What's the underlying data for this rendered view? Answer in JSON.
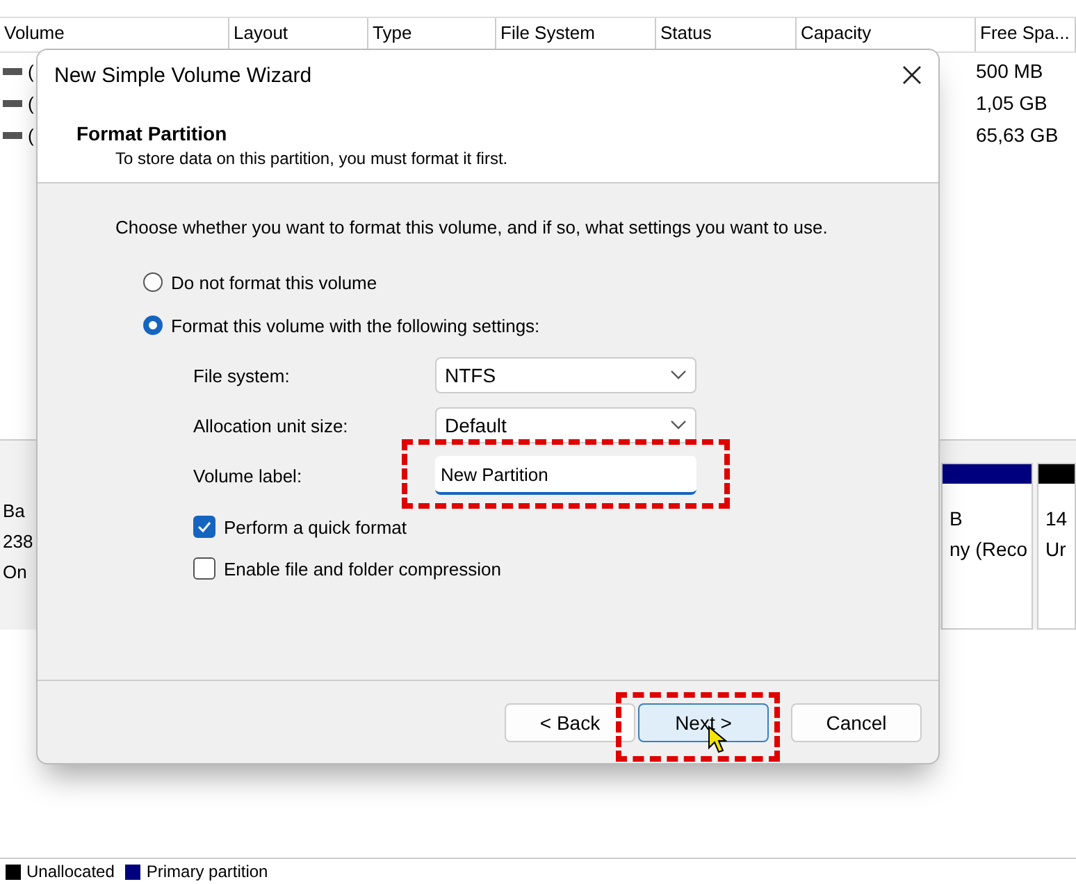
{
  "background": {
    "columns": [
      "Volume",
      "Layout",
      "Type",
      "File System",
      "Status",
      "Capacity",
      "Free Spa..."
    ],
    "rows": [
      {
        "volume": "(",
        "free_space": "500 MB"
      },
      {
        "volume": "(",
        "free_space": "1,05 GB"
      },
      {
        "volume": "(",
        "free_space": "65,63 GB"
      }
    ],
    "disk": {
      "lines": [
        "Ba",
        "238",
        "On"
      ]
    },
    "partitions": [
      {
        "color": "#00007f",
        "lines": [
          "B",
          "ny (Reco"
        ]
      },
      {
        "color": "#000000",
        "lines": [
          "14",
          "Ur"
        ]
      }
    ],
    "legend": [
      {
        "label": "Unallocated",
        "color": "#000000"
      },
      {
        "label": "Primary partition",
        "color": "#00007f"
      }
    ]
  },
  "dialog": {
    "title": "New Simple Volume Wizard",
    "heading": "Format Partition",
    "subtitle": "To store data on this partition, you must format it first.",
    "instruction": "Choose whether you want to format this volume, and if so, what settings you want to use.",
    "radios": [
      {
        "label": "Do not format this volume",
        "selected": false
      },
      {
        "label": "Format this volume with the following settings:",
        "selected": true
      }
    ],
    "fields": [
      {
        "label": "File system:",
        "kind": "dropdown",
        "value": "NTFS",
        "highlighted": false
      },
      {
        "label": "Allocation unit size:",
        "kind": "dropdown",
        "value": "Default",
        "highlighted": false
      },
      {
        "label": "Volume label:",
        "kind": "text",
        "value": "New Partition",
        "highlighted": true
      }
    ],
    "checkboxes": [
      {
        "label": "Perform a quick format",
        "checked": true
      },
      {
        "label": "Enable file and folder compression",
        "checked": false
      }
    ],
    "buttons": [
      {
        "label": "< Back",
        "hovered": false,
        "highlighted": false
      },
      {
        "label": "Next >",
        "hovered": true,
        "highlighted": true
      },
      {
        "label": "Cancel",
        "hovered": false,
        "highlighted": false
      }
    ]
  }
}
